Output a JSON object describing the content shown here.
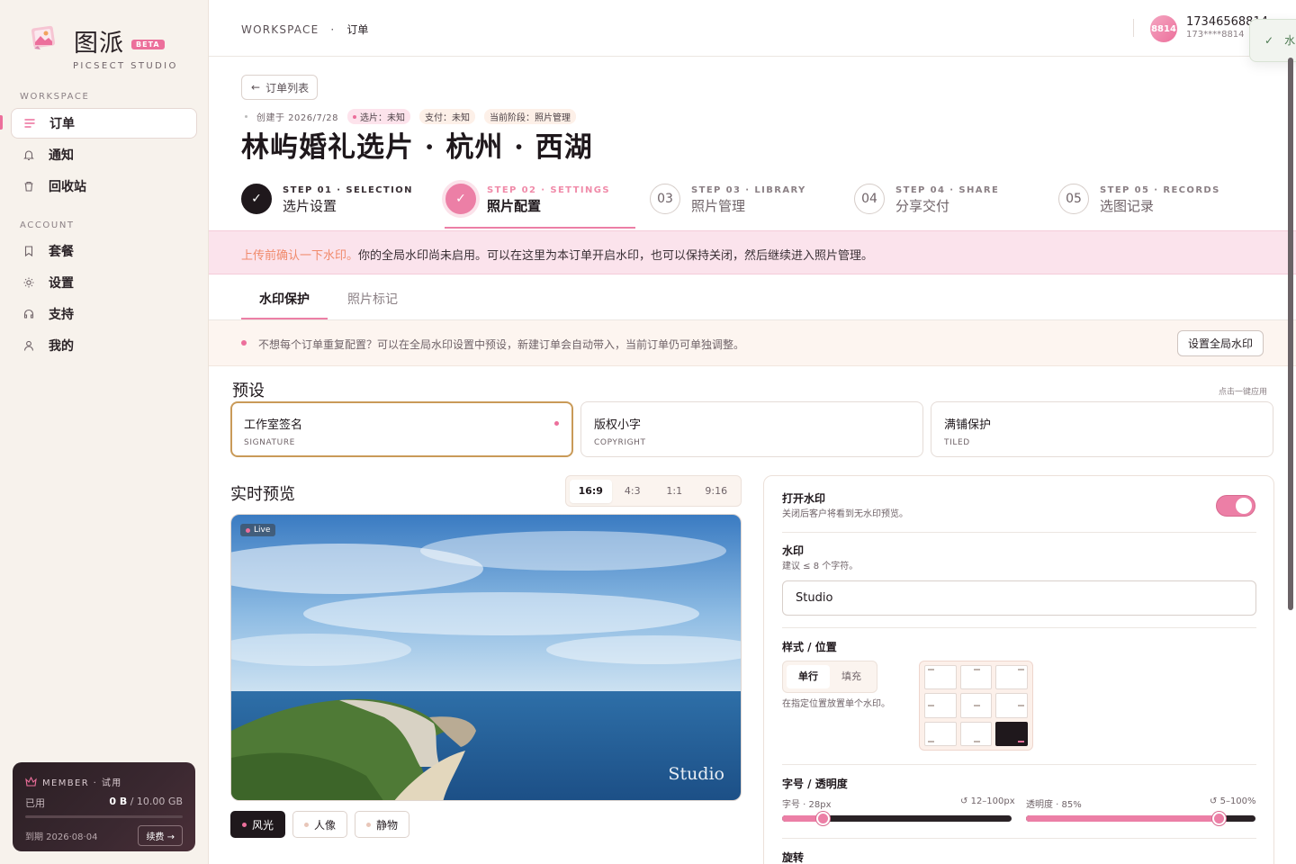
{
  "brand": {
    "name": "图派",
    "badge": "BETA",
    "sub": "PICSECT STUDIO"
  },
  "sidebar": {
    "section_workspace": "WORKSPACE",
    "section_account": "ACCOUNT",
    "items": [
      {
        "label": "订单",
        "icon": "list-icon"
      },
      {
        "label": "通知",
        "icon": "bell-icon"
      },
      {
        "label": "回收站",
        "icon": "trash-icon"
      },
      {
        "label": "套餐",
        "icon": "bookmark-icon"
      },
      {
        "label": "设置",
        "icon": "sun-gear-icon"
      },
      {
        "label": "支持",
        "icon": "headset-icon"
      },
      {
        "label": "我的",
        "icon": "user-icon"
      }
    ],
    "member": {
      "title": "MEMBER · 试用",
      "used_label": "已用",
      "used": "0 B",
      "total": "/ 10.00 GB",
      "usage_fraction": 0,
      "expire": "到期 2026·08·04",
      "renew": "续费 →"
    }
  },
  "topbar": {
    "crumb_root": "WORKSPACE",
    "crumb_sep": "·",
    "crumb_current": "订单",
    "avatar_text": "8814",
    "user_name": "17346568814",
    "user_sub": "173****8814",
    "toast_text": "水"
  },
  "header": {
    "back": "订单列表",
    "created": "创建于 2026/7/28",
    "tag_selection": "选片：未知",
    "tag_payment": "支付：未知",
    "tag_stage": "当前阶段：照片管理",
    "title": "林屿婚礼选片 · 杭州 · 西湖"
  },
  "steps": [
    {
      "num": "✓",
      "code": "STEP 01 · SELECTION",
      "label": "选片设置",
      "state": "done"
    },
    {
      "num": "✓",
      "code": "STEP 02 · SETTINGS",
      "label": "照片配置",
      "state": "current"
    },
    {
      "num": "03",
      "code": "STEP 03 · LIBRARY",
      "label": "照片管理",
      "state": "todo"
    },
    {
      "num": "04",
      "code": "STEP 04 · SHARE",
      "label": "分享交付",
      "state": "todo"
    },
    {
      "num": "05",
      "code": "STEP 05 · RECORDS",
      "label": "选图记录",
      "state": "todo"
    }
  ],
  "banner": {
    "highlight": "上传前确认一下水印。",
    "text": "你的全局水印尚未启用。可以在这里为本订单开启水印，也可以保持关闭，然后继续进入照片管理。"
  },
  "tabs": [
    {
      "label": "水印保护"
    },
    {
      "label": "照片标记"
    }
  ],
  "tip": {
    "text": "不想每个订单重复配置？可以在全局水印设置中预设，新建订单会自动带入，当前订单仍可单独调整。",
    "button": "设置全局水印"
  },
  "presets": {
    "title": "预设",
    "hint": "点击一键应用",
    "items": [
      {
        "name": "工作室签名",
        "code": "SIGNATURE"
      },
      {
        "name": "版权小字",
        "code": "COPYRIGHT"
      },
      {
        "name": "满铺保护",
        "code": "TILED"
      }
    ]
  },
  "preview": {
    "title": "实时预览",
    "ratios": [
      "16:9",
      "4:3",
      "1:1",
      "9:16"
    ],
    "selected_ratio": "16:9",
    "live": "Live",
    "watermark": "Studio",
    "scenes": [
      "风光",
      "人像",
      "静物"
    ],
    "selected_scene": "风光"
  },
  "settings": {
    "toggle_title": "打开水印",
    "toggle_sub": "关闭后客户将看到无水印预览。",
    "toggle_on": true,
    "wm_title": "水印",
    "wm_sub": "建议 ≤ 8 个字符。",
    "wm_value": "Studio",
    "style_title": "样式 / 位置",
    "style_options": [
      "单行",
      "填充"
    ],
    "style_selected": "单行",
    "style_sub": "在指定位置放置单个水印。",
    "position_selected": "bottom-right",
    "size_title": "字号 / 透明度",
    "font_label": "字号 · 28px",
    "font_range": "12–100px",
    "font_value": 28,
    "font_min": 12,
    "font_max": 100,
    "opacity_label": "透明度 · 85%",
    "opacity_range": "5–100%",
    "opacity_value": 85,
    "opacity_min": 5,
    "opacity_max": 100,
    "rotate_title": "旋转"
  },
  "colors": {
    "accent": "#ec6f9b",
    "gold": "#c99a58",
    "dark": "#1f181c"
  }
}
